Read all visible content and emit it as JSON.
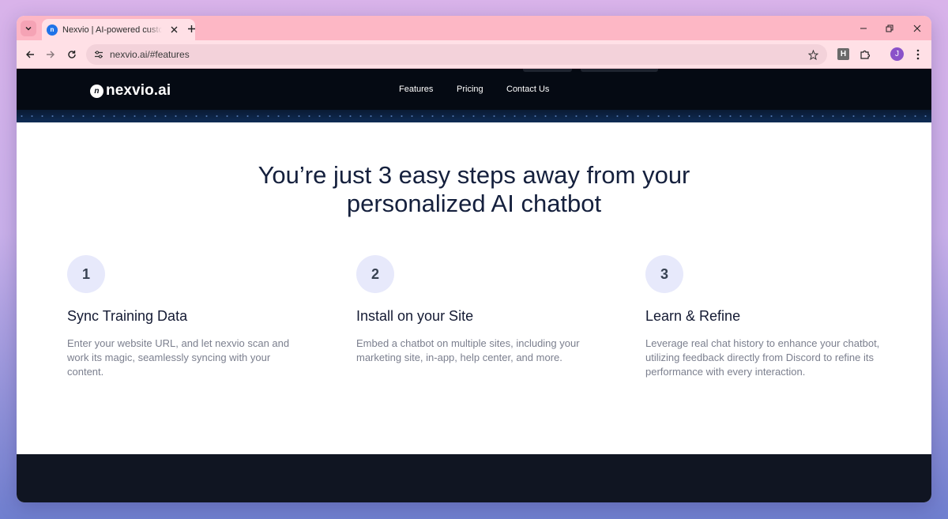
{
  "browser": {
    "tab": {
      "title": "Nexvio | AI-powered customer support",
      "favicon_icon": "nexvio-favicon-icon"
    },
    "address_bar": {
      "url": "nexvio.ai/#features"
    },
    "extension": {
      "label": "H"
    },
    "profile": {
      "initial": "J"
    }
  },
  "site": {
    "logo_text": "nexvio.ai",
    "logo_mark": "n",
    "nav": {
      "features": "Features",
      "pricing": "Pricing",
      "contact": "Contact Us"
    }
  },
  "features": {
    "headline_line1": "You’re just 3 easy steps away from your",
    "headline_line2": "personalized AI chatbot",
    "steps": [
      {
        "number": "1",
        "title": "Sync Training Data",
        "description": "Enter your website URL, and let nexvio scan and work its magic, seamlessly syncing with your content."
      },
      {
        "number": "2",
        "title": "Install on your Site",
        "description": "Embed a chatbot on multiple sites, including your marketing site, in-app, help center, and more."
      },
      {
        "number": "3",
        "title": "Learn & Refine",
        "description": "Leverage real chat history to enhance your chatbot, utilizing feedback directly from Discord to refine its performance with every interaction."
      }
    ]
  },
  "colors": {
    "tabstrip": "#fdb7c5",
    "toolbar": "#ffe0e6",
    "site_nav": "#050a13",
    "step_circle": "#e7e9fb",
    "headline": "#15203d"
  }
}
